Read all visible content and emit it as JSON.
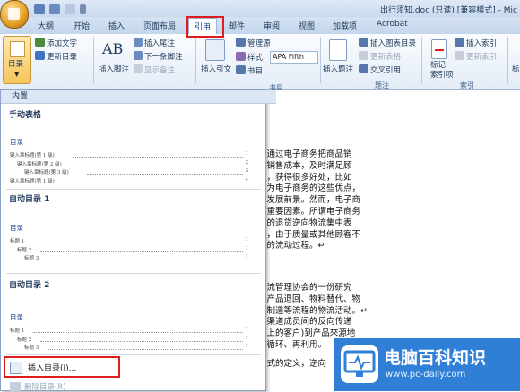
{
  "window": {
    "title": "出行须知.doc (只读) [兼容模式] - Mic"
  },
  "tabs": [
    "大纲",
    "开始",
    "插入",
    "页面布局",
    "引用",
    "邮件",
    "审阅",
    "视图",
    "加载项",
    "Acrobat"
  ],
  "active_tab": "引用",
  "ribbon": {
    "toc_group": {
      "toc_button": "目录",
      "add_text": "添加文字",
      "update_toc": "更新目录"
    },
    "footnote_group": {
      "insert_footnote": "插入脚注",
      "insert_endnote": "插入尾注",
      "next_footnote": "下一条脚注",
      "show_notes": "显示备注",
      "ab_glyph": "AB",
      "label": "脚注"
    },
    "citation_group": {
      "insert_citation": "插入引文",
      "manage_sources": "管理源",
      "style_label": "样式",
      "style_value": "APA Fifth",
      "bibliography": "书目",
      "label": "书目"
    },
    "caption_group": {
      "insert_caption": "插入题注",
      "insert_table_of_figures": "插入图表目录",
      "update_table": "更新表格",
      "cross_reference": "交叉引用",
      "label": "题注"
    },
    "index_group": {
      "mark_entry": "标记\n索引项",
      "insert_index": "插入索引",
      "update_index": "更新索引",
      "label": "索引"
    },
    "right_cut": "标"
  },
  "toc_panel": {
    "header": "内置",
    "sections": [
      {
        "title": "手动表格",
        "heading": "目录",
        "lines": [
          {
            "text": "键入章标题(第 1 级)",
            "page": "1",
            "indent": 0
          },
          {
            "text": "键入章标题(第 2 级)",
            "page": "2",
            "indent": 1
          },
          {
            "text": "键入章标题(第 3 级)",
            "page": "3",
            "indent": 2
          },
          {
            "text": "键入章标题(第 1 级)",
            "page": "4",
            "indent": 0
          }
        ]
      },
      {
        "title": "自动目录 1",
        "heading": "目录",
        "lines": [
          {
            "text": "标题 1",
            "page": "1",
            "indent": 0
          },
          {
            "text": "标题 2",
            "page": "1",
            "indent": 1
          },
          {
            "text": "标题 3",
            "page": "1",
            "indent": 2
          }
        ]
      },
      {
        "title": "自动目录 2",
        "heading": "目录",
        "lines": [
          {
            "text": "标题 1",
            "page": "1",
            "indent": 0
          },
          {
            "text": "标题 2",
            "page": "1",
            "indent": 1
          },
          {
            "text": "标题 3",
            "page": "1",
            "indent": 2
          }
        ]
      }
    ],
    "insert_toc": "插入目录(I)...",
    "delete_toc": "删除目录(R)"
  },
  "document": {
    "paragraph1": [
      "业通过电子商务把商品销",
      "纸销售成本，及时满足顾",
      "品，获得很多好处，比如",
      "因为电子商务的这些优点，",
      "的发展前景。然而，电子商",
      "个重要因素。所谓电子商务",
      "务的退货逆向物流集中表",
      "品，由于质量或其他顾客不",
      "商的流动过程。↵"
    ],
    "paragraph2": [
      "物流管理协会的一份研究",
      "了产品退回、物料替代、物",
      "再制造等流程的物流活动。↵",
      "在渠道成员间的反向传递",
      "游上的客户)到产品來源地",
      "再循环、再利用。",
      "正式的定义，逆向"
    ]
  },
  "watermark": {
    "main": "电脑百科知识",
    "url": "www.pc-daily.com"
  },
  "colors": {
    "highlight": "#e01d1d",
    "ribbon_blue": "#15428b",
    "watermark_bg": "#2f7fd6"
  }
}
